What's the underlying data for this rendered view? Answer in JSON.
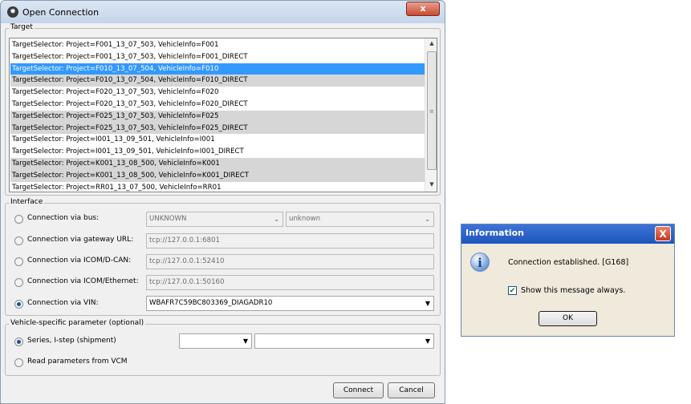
{
  "window": {
    "title": "Open Connection",
    "close_label": "x"
  },
  "target": {
    "group_label": "Target",
    "items": [
      "TargetSelector: Project=F001_13_07_503, VehicleInfo=F001",
      "TargetSelector: Project=F001_13_07_503, VehicleInfo=F001_DIRECT",
      "TargetSelector: Project=F010_13_07_504, VehicleInfo=F010",
      "TargetSelector: Project=F010_13_07_504, VehicleInfo=F010_DIRECT",
      "TargetSelector: Project=F020_13_07_503, VehicleInfo=F020",
      "TargetSelector: Project=F020_13_07_503, VehicleInfo=F020_DIRECT",
      "TargetSelector: Project=F025_13_07_503, VehicleInfo=F025",
      "TargetSelector: Project=F025_13_07_503, VehicleInfo=F025_DIRECT",
      "TargetSelector: Project=I001_13_09_501, VehicleInfo=I001",
      "TargetSelector: Project=I001_13_09_501, VehicleInfo=I001_DIRECT",
      "TargetSelector: Project=K001_13_08_500, VehicleInfo=K001",
      "TargetSelector: Project=K001_13_08_500, VehicleInfo=K001_DIRECT",
      "TargetSelector: Project=RR01_13_07_500, VehicleInfo=RR01"
    ],
    "selected_index": 2
  },
  "interface": {
    "group_label": "Interface",
    "bus_label": "Connection via bus:",
    "bus_value": "UNKNOWN",
    "bus_value2": "unknown",
    "gateway_label": "Connection via gateway URL:",
    "gateway_value": "tcp://127.0.0.1:6801",
    "icom_dcan_label": "Connection via ICOM/D-CAN:",
    "icom_dcan_value": "tcp://127.0.0.1:52410",
    "icom_eth_label": "Connection via ICOM/Ethernet:",
    "icom_eth_value": "tcp://127.0.0.1:50160",
    "vin_label": "Connection via VIN:",
    "vin_value": "WBAFR7C59BC803369_DIAGADR10",
    "selected": "vin"
  },
  "vehicle": {
    "group_label": "Vehicle-specific parameter (optional)",
    "series_label": "Series, I-step (shipment)",
    "read_label": "Read parameters from VCM",
    "selected": "series"
  },
  "buttons": {
    "connect": "Connect",
    "cancel": "Cancel"
  },
  "info_dialog": {
    "title": "Information",
    "close_label": "X",
    "message": "Connection established. [G168]",
    "checkbox_label": "Show this message always.",
    "checkbox_checked": true,
    "ok": "OK"
  },
  "colors": {
    "selection": "#3399ff",
    "alt_row": "#d6d6d6",
    "info_title": "#2a62c9"
  }
}
